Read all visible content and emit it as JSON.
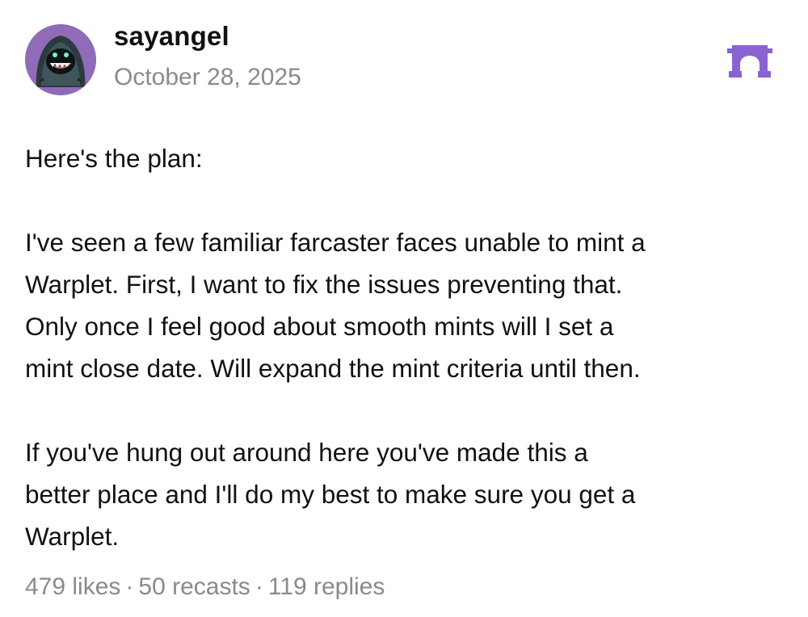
{
  "author": {
    "username": "sayangel",
    "date": "October 28, 2025",
    "avatar_icon": "hooded-monster-avatar"
  },
  "brand": {
    "logo_icon": "farcaster-arch-icon",
    "color": "#8a63d2"
  },
  "post": {
    "paragraphs": [
      "Here's the plan:",
      "I've seen a few familiar farcaster faces unable to mint a\nWarplet. First, I want to fix the issues preventing that.\nOnly once I feel good about smooth mints will I set a\nmint close date. Will expand the mint criteria until then.",
      "If you've hung out around here you've made this a\nbetter place and I'll do my best to make sure you get a\nWarplet."
    ]
  },
  "stats": {
    "likes": "479 likes",
    "separator": "·",
    "recasts": "50 recasts",
    "replies": "119 replies"
  }
}
